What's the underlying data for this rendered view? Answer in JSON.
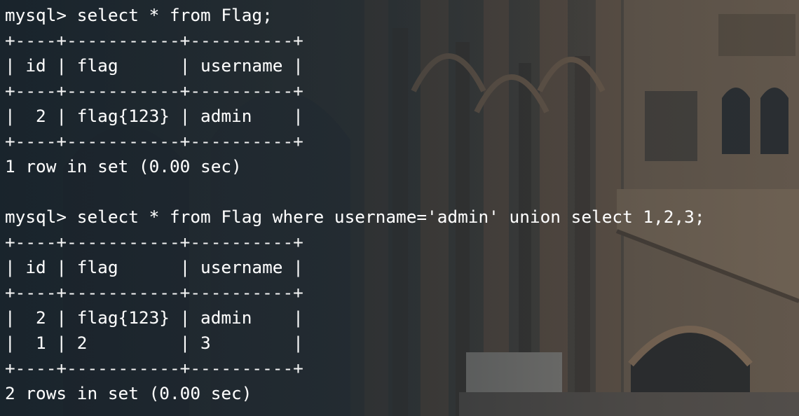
{
  "terminal": {
    "lines": [
      {
        "kind": "prompt",
        "text": "mysql> select * from Flag;"
      },
      {
        "kind": "border",
        "text": "+----+-----------+----------+"
      },
      {
        "kind": "header",
        "text": "| id | flag      | username |"
      },
      {
        "kind": "border",
        "text": "+----+-----------+----------+"
      },
      {
        "kind": "row",
        "text": "|  2 | flag{123} | admin    |"
      },
      {
        "kind": "border",
        "text": "+----+-----------+----------+"
      },
      {
        "kind": "status",
        "text": "1 row in set (0.00 sec)"
      },
      {
        "kind": "blank",
        "text": ""
      },
      {
        "kind": "prompt",
        "text": "mysql> select * from Flag where username='admin' union select 1,2,3;"
      },
      {
        "kind": "border",
        "text": "+----+-----------+----------+"
      },
      {
        "kind": "header",
        "text": "| id | flag      | username |"
      },
      {
        "kind": "border",
        "text": "+----+-----------+----------+"
      },
      {
        "kind": "row",
        "text": "|  2 | flag{123} | admin    |"
      },
      {
        "kind": "row",
        "text": "|  1 | 2         | 3        |"
      },
      {
        "kind": "border",
        "text": "+----+-----------+----------+"
      },
      {
        "kind": "status",
        "text": "2 rows in set (0.00 sec)"
      }
    ]
  },
  "colors": {
    "text": "#ffffff",
    "background": "#1f2a33"
  }
}
